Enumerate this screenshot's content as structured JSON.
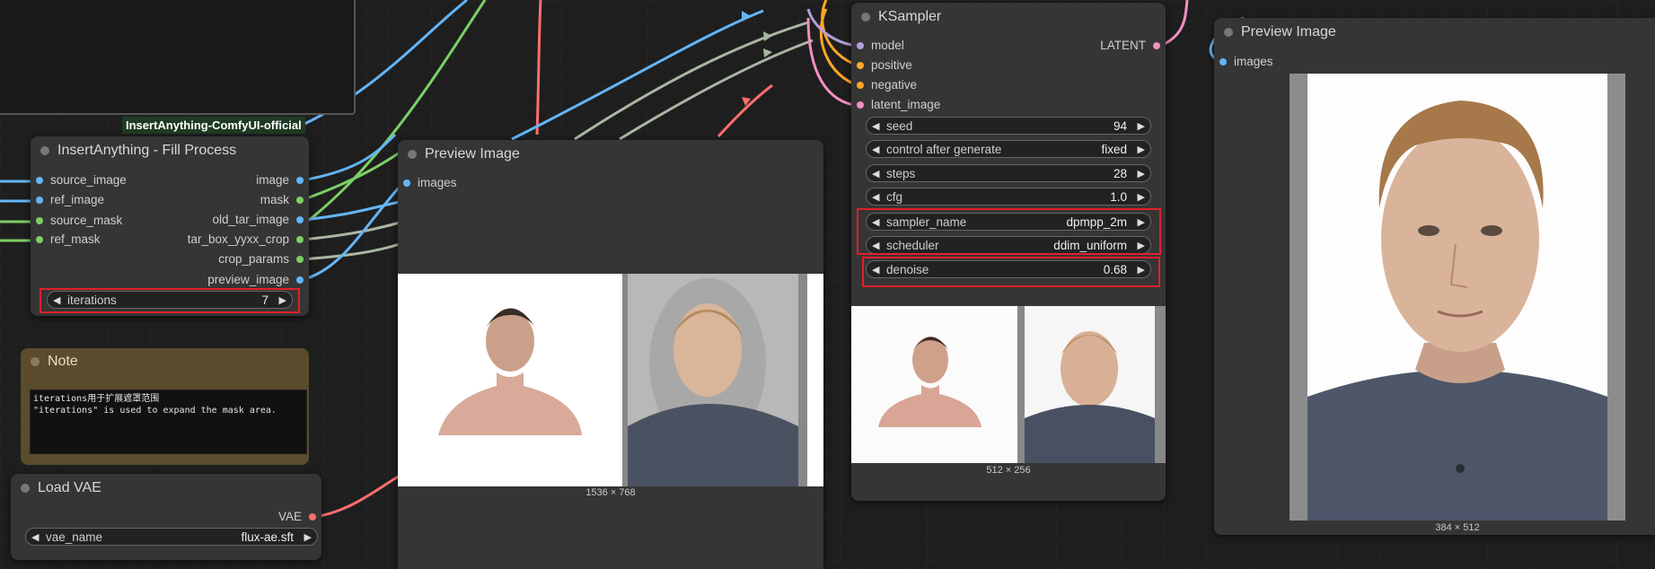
{
  "group": {
    "label": "InsertAnything-ComfyUI-official"
  },
  "fill_process": {
    "title": "InsertAnything - Fill Process",
    "inputs": [
      "source_image",
      "ref_image",
      "source_mask",
      "ref_mask"
    ],
    "outputs": [
      "image",
      "mask",
      "old_tar_image",
      "tar_box_yyxx_crop",
      "crop_params",
      "preview_image"
    ],
    "iterations_label": "iterations",
    "iterations_value": "7"
  },
  "note": {
    "title": "Note",
    "text": "iterations用于扩展遮罩范围\n\"iterations\" is used to expand the mask area."
  },
  "load_vae": {
    "title": "Load VAE",
    "output": "VAE",
    "vae_name_label": "vae_name",
    "vae_name_value": "flux-ae.sft"
  },
  "preview1": {
    "title": "Preview Image",
    "input": "images",
    "size": "1536 × 768"
  },
  "ksampler": {
    "title": "KSampler",
    "inputs": [
      "model",
      "positive",
      "negative",
      "latent_image"
    ],
    "output": "LATENT",
    "widgets": [
      {
        "label": "seed",
        "value": "94"
      },
      {
        "label": "control after generate",
        "value": "fixed"
      },
      {
        "label": "steps",
        "value": "28"
      },
      {
        "label": "cfg",
        "value": "1.0"
      },
      {
        "label": "sampler_name",
        "value": "dpmpp_2m"
      },
      {
        "label": "scheduler",
        "value": "ddim_uniform"
      },
      {
        "label": "denoise",
        "value": "0.68"
      }
    ],
    "size": "512 × 256"
  },
  "preview2": {
    "title": "Preview Image",
    "input": "images",
    "size": "384 × 512"
  },
  "colors": {
    "image_link": "#64b5f6",
    "mask_link": "#7ccf65",
    "vae_link": "#ff6e6e",
    "highlight": "#e0202a"
  },
  "icons": [
    "arrow-left-icon",
    "arrow-right-icon",
    "node-collapse-dot-icon"
  ]
}
